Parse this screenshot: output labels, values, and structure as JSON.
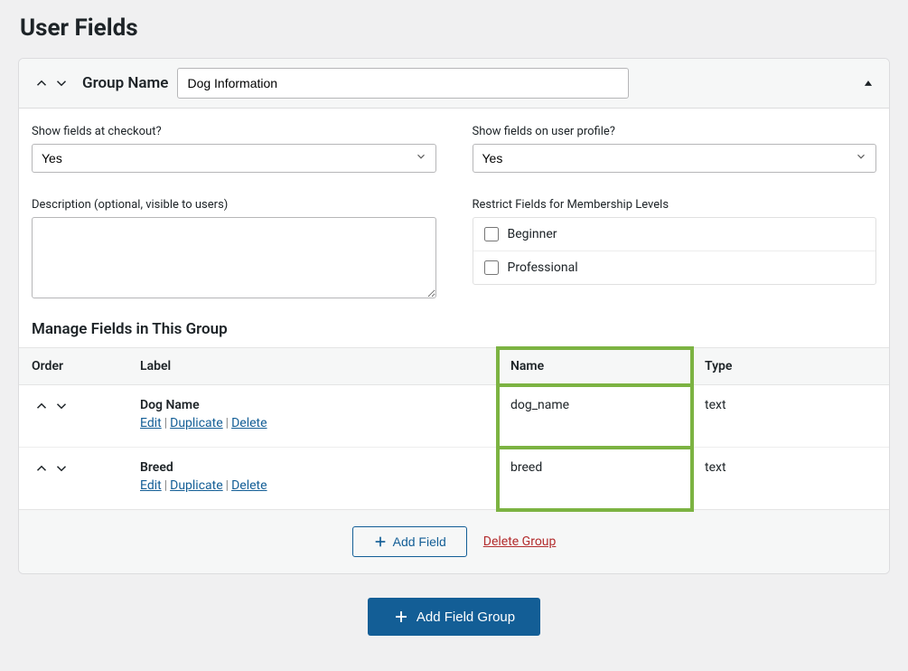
{
  "page": {
    "title": "User Fields"
  },
  "group": {
    "name_label": "Group Name",
    "name_value": "Dog Information",
    "show_checkout": {
      "label": "Show fields at checkout?",
      "value": "Yes"
    },
    "show_profile": {
      "label": "Show fields on user profile?",
      "value": "Yes"
    },
    "description": {
      "label": "Description (optional, visible to users)",
      "value": ""
    },
    "restrict": {
      "label": "Restrict Fields for Membership Levels",
      "levels": [
        {
          "label": "Beginner",
          "checked": false
        },
        {
          "label": "Professional",
          "checked": false
        }
      ]
    }
  },
  "manage": {
    "title": "Manage Fields in This Group",
    "headers": {
      "order": "Order",
      "label": "Label",
      "name": "Name",
      "type": "Type"
    },
    "actions": {
      "edit": "Edit",
      "duplicate": "Duplicate",
      "delete": "Delete"
    },
    "rows": [
      {
        "label": "Dog Name",
        "name": "dog_name",
        "type": "text"
      },
      {
        "label": "Breed",
        "name": "breed",
        "type": "text"
      }
    ]
  },
  "footer": {
    "add_field": "Add Field",
    "delete_group": "Delete Group",
    "add_group": "Add Field Group"
  }
}
